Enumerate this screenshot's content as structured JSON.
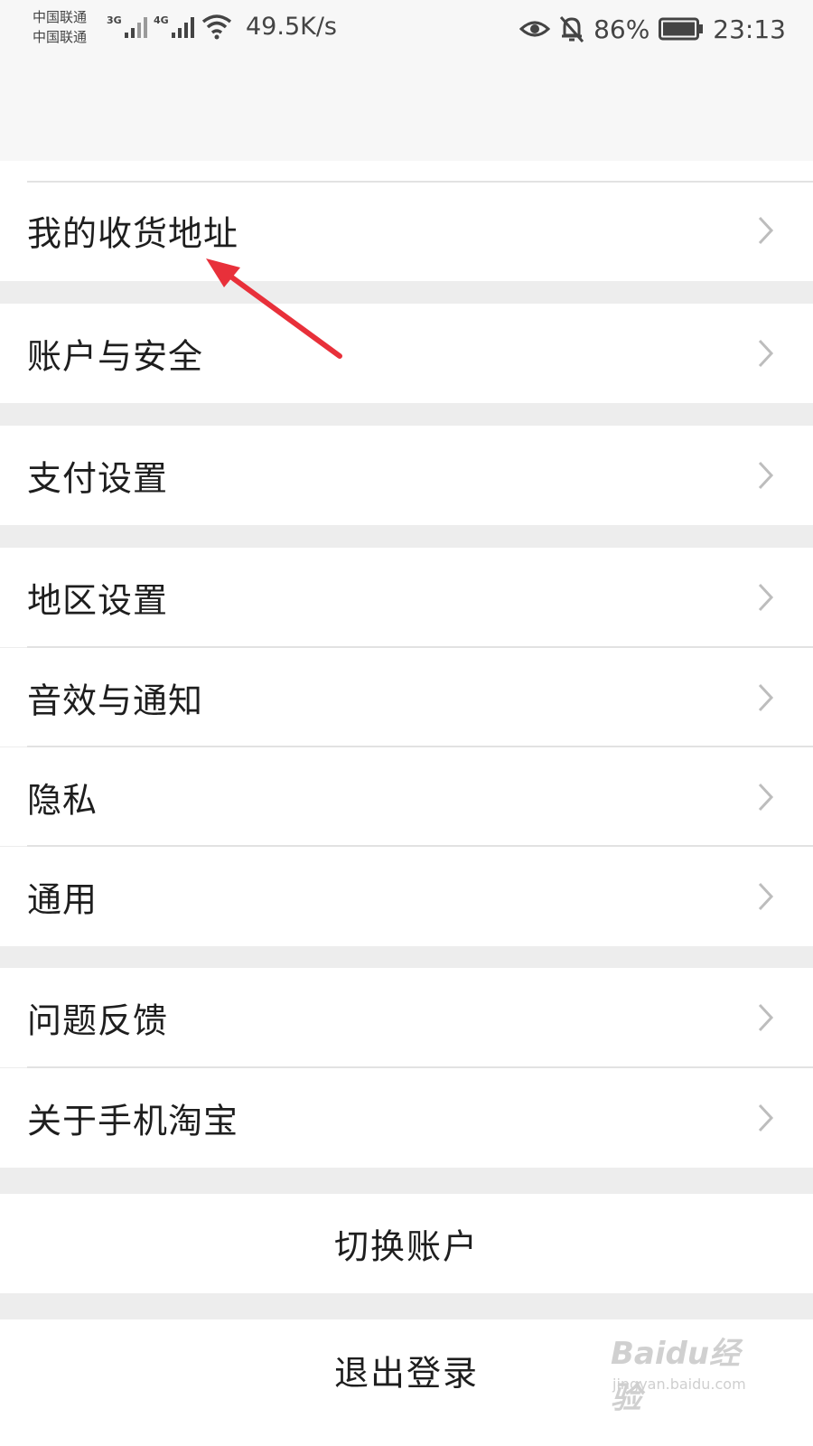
{
  "status_bar": {
    "carrier_1": "中国联通",
    "carrier_2": "中国联通",
    "network_1": "3G",
    "network_2": "4G",
    "net_speed": "49.5K/s",
    "battery_percent": "86%",
    "time": "23:13",
    "icons": [
      "signal-icon",
      "wifi-icon",
      "eye-icon",
      "bell-off-icon",
      "battery-icon"
    ]
  },
  "menu": {
    "shipping_address": "我的收货地址",
    "account_security": "账户与安全",
    "payment_settings": "支付设置",
    "region_settings": "地区设置",
    "sound_notifications": "音效与通知",
    "privacy": "隐私",
    "general": "通用",
    "feedback": "问题反馈",
    "about": "关于手机淘宝"
  },
  "actions": {
    "switch_account": "切换账户",
    "logout": "退出登录"
  },
  "watermark": {
    "brand": "Baidu经验",
    "url": "jingyan.baidu.com"
  },
  "colors": {
    "annotation_arrow": "#e8303a",
    "row_background": "#ffffff",
    "section_gap": "#ededed"
  }
}
